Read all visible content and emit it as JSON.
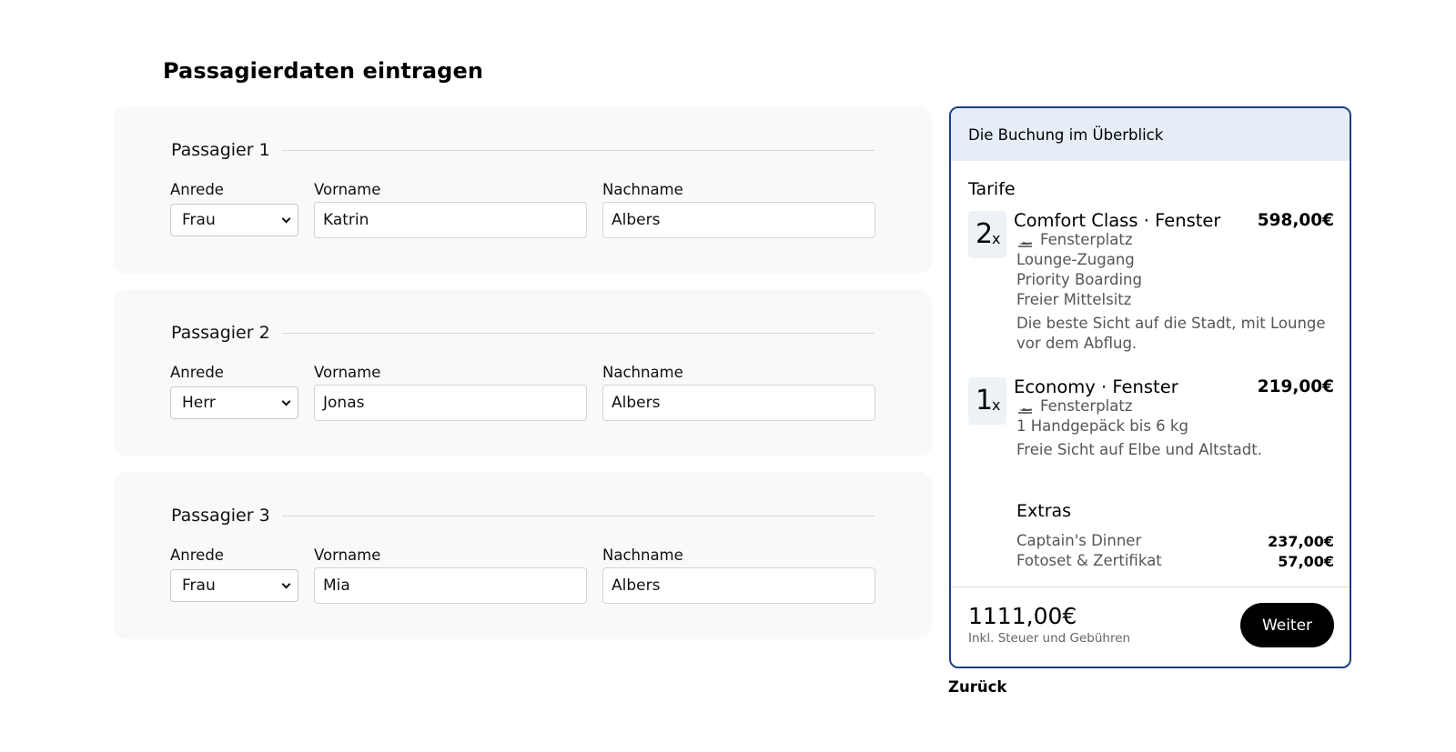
{
  "page": {
    "title": "Passagierdaten eintragen"
  },
  "passengers": [
    {
      "heading": "Passagier 1",
      "anrede_label": "Anrede",
      "vorname_label": "Vorname",
      "nachname_label": "Nachname",
      "anrede": "Frau",
      "vorname": "Katrin",
      "nachname": "Albers"
    },
    {
      "heading": "Passagier 2",
      "anrede_label": "Anrede",
      "vorname_label": "Vorname",
      "nachname_label": "Nachname",
      "anrede": "Herr",
      "vorname": "Jonas",
      "nachname": "Albers"
    },
    {
      "heading": "Passagier 3",
      "anrede_label": "Anrede",
      "vorname_label": "Vorname",
      "nachname_label": "Nachname",
      "anrede": "Frau",
      "vorname": "Mia",
      "nachname": "Albers"
    }
  ],
  "summary": {
    "header": "Die Buchung im Überblick",
    "tarife_title": "Tarife",
    "tarife": [
      {
        "qty": "2",
        "qty_suffix": "x",
        "name": "Comfort Class · Fenster",
        "price": "598,00€",
        "features": [
          "Fensterplatz",
          "Lounge-Zugang",
          "Priority Boarding",
          "Freier Mittelsitz"
        ],
        "description": "Die beste Sicht auf die Stadt, mit Lounge vor dem Abflug."
      },
      {
        "qty": "1",
        "qty_suffix": "x",
        "name": "Economy · Fenster",
        "price": "219,00€",
        "features": [
          "Fensterplatz",
          "1 Handgepäck bis 6 kg"
        ],
        "description": "Freie Sicht auf Elbe und Altstadt."
      }
    ],
    "extras_title": "Extras",
    "extras": [
      {
        "name": "Captain's Dinner",
        "price": "237,00€"
      },
      {
        "name": "Fotoset & Zertifikat",
        "price": "57,00€"
      }
    ],
    "total": "1111,00€",
    "total_note": "Inkl. Steuer und Gebühren",
    "next_button": "Weiter",
    "feature_icon": "airplane-icon"
  },
  "back_link": "Zurück"
}
